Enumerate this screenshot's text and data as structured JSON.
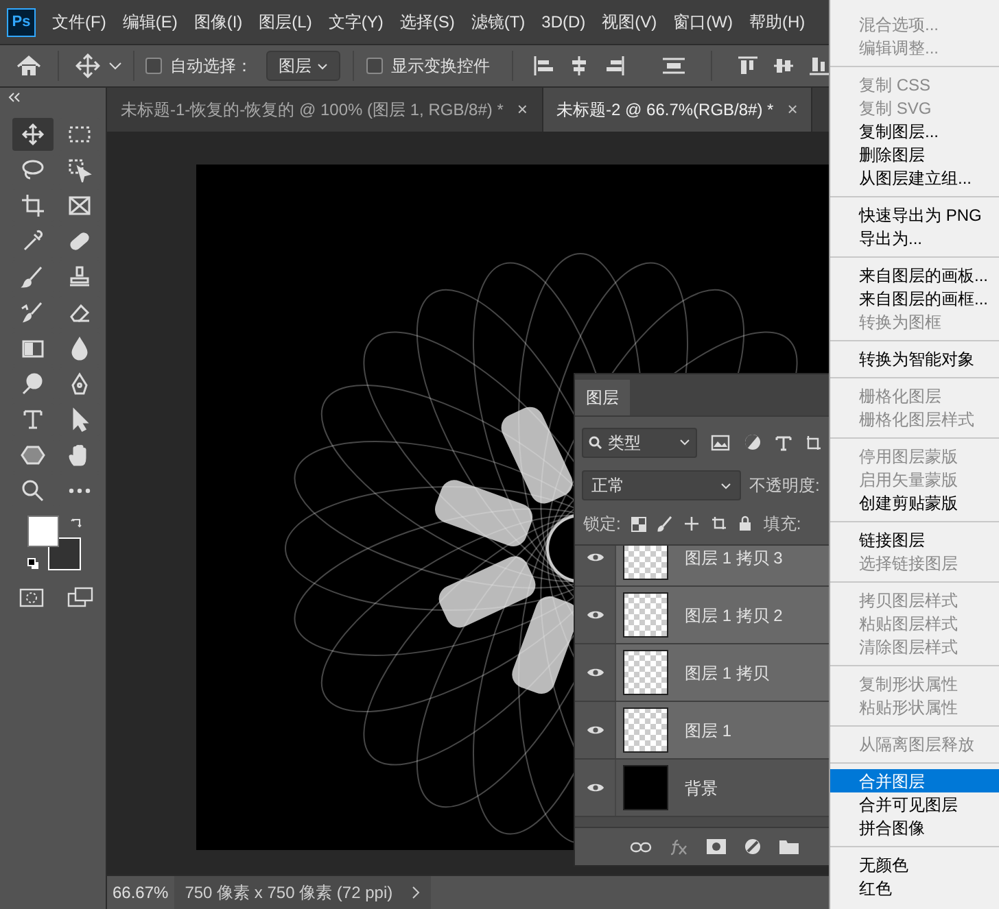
{
  "menubar": {
    "logo": "Ps",
    "items": [
      "文件(F)",
      "编辑(E)",
      "图像(I)",
      "图层(L)",
      "文字(Y)",
      "选择(S)",
      "滤镜(T)",
      "3D(D)",
      "视图(V)",
      "窗口(W)",
      "帮助(H)"
    ]
  },
  "options_bar": {
    "auto_select": {
      "label": "自动选择：",
      "checked": false
    },
    "target": {
      "value": "图层"
    },
    "show_transform": {
      "label": "显示变换控件",
      "checked": false
    }
  },
  "document_tabs": [
    {
      "title": "未标题-1-恢复的-恢复的 @ 100% (图层 1, RGB/8#) *",
      "close": "×",
      "selected": false
    },
    {
      "title": "未标题-2 @ 66.7%(RGB/8#) *",
      "close": "×",
      "selected": true
    }
  ],
  "toolbar": {
    "tools": [
      {
        "selected": true
      },
      {
        "selected": false
      },
      {
        "selected": false
      },
      {
        "selected": false
      },
      {
        "selected": false
      },
      {
        "selected": false
      },
      {
        "selected": false
      },
      {
        "selected": false
      },
      {
        "selected": false
      },
      {
        "selected": false
      },
      {
        "selected": false
      },
      {
        "selected": false
      },
      {
        "selected": false
      },
      {
        "selected": false
      },
      {
        "selected": false
      },
      {
        "selected": false
      },
      {
        "selected": false
      },
      {
        "selected": false
      },
      {
        "selected": false
      },
      {
        "selected": false
      },
      {
        "selected": false
      },
      {
        "selected": false
      }
    ]
  },
  "layers_panel": {
    "tab": "图层",
    "filter": "类型",
    "blend_mode": "正常",
    "opacity_label": "不透明度:",
    "lock_label": "锁定:",
    "fill_label": "填充:",
    "layers": [
      {
        "name": "图层 1 拷贝 3",
        "visible": true,
        "selected": true,
        "kind": "transparent"
      },
      {
        "name": "图层 1 拷贝 2",
        "visible": true,
        "selected": true,
        "kind": "transparent"
      },
      {
        "name": "图层 1 拷贝",
        "visible": true,
        "selected": true,
        "kind": "transparent"
      },
      {
        "name": "图层 1",
        "visible": true,
        "selected": true,
        "kind": "transparent"
      },
      {
        "name": "背景",
        "visible": true,
        "selected": false,
        "kind": "background"
      }
    ]
  },
  "status_bar": {
    "zoom": "66.67%",
    "doc_info": "750 像素 x 750 像素 (72 ppi)"
  },
  "context_menu": {
    "items": [
      {
        "kind": "item",
        "label": "混合选项...",
        "disabled": true,
        "selected": false
      },
      {
        "kind": "item",
        "label": "编辑调整...",
        "disabled": true,
        "selected": false
      },
      {
        "kind": "separator"
      },
      {
        "kind": "item",
        "label": "复制 CSS",
        "disabled": true,
        "selected": false
      },
      {
        "kind": "item",
        "label": "复制 SVG",
        "disabled": true,
        "selected": false
      },
      {
        "kind": "item",
        "label": "复制图层...",
        "disabled": false,
        "selected": false
      },
      {
        "kind": "item",
        "label": "删除图层",
        "disabled": false,
        "selected": false
      },
      {
        "kind": "item",
        "label": "从图层建立组...",
        "disabled": false,
        "selected": false
      },
      {
        "kind": "separator"
      },
      {
        "kind": "item",
        "label": "快速导出为 PNG",
        "disabled": false,
        "selected": false
      },
      {
        "kind": "item",
        "label": "导出为...",
        "disabled": false,
        "selected": false
      },
      {
        "kind": "separator"
      },
      {
        "kind": "item",
        "label": "来自图层的画板...",
        "disabled": false,
        "selected": false
      },
      {
        "kind": "item",
        "label": "来自图层的画框...",
        "disabled": false,
        "selected": false
      },
      {
        "kind": "item",
        "label": "转换为图框",
        "disabled": true,
        "selected": false
      },
      {
        "kind": "separator"
      },
      {
        "kind": "item",
        "label": "转换为智能对象",
        "disabled": false,
        "selected": false
      },
      {
        "kind": "separator"
      },
      {
        "kind": "item",
        "label": "栅格化图层",
        "disabled": true,
        "selected": false
      },
      {
        "kind": "item",
        "label": "栅格化图层样式",
        "disabled": true,
        "selected": false
      },
      {
        "kind": "separator"
      },
      {
        "kind": "item",
        "label": "停用图层蒙版",
        "disabled": true,
        "selected": false
      },
      {
        "kind": "item",
        "label": "启用矢量蒙版",
        "disabled": true,
        "selected": false
      },
      {
        "kind": "item",
        "label": "创建剪贴蒙版",
        "disabled": false,
        "selected": false
      },
      {
        "kind": "separator"
      },
      {
        "kind": "item",
        "label": "链接图层",
        "disabled": false,
        "selected": false
      },
      {
        "kind": "item",
        "label": "选择链接图层",
        "disabled": true,
        "selected": false
      },
      {
        "kind": "separator"
      },
      {
        "kind": "item",
        "label": "拷贝图层样式",
        "disabled": true,
        "selected": false
      },
      {
        "kind": "item",
        "label": "粘贴图层样式",
        "disabled": true,
        "selected": false
      },
      {
        "kind": "item",
        "label": "清除图层样式",
        "disabled": true,
        "selected": false
      },
      {
        "kind": "separator"
      },
      {
        "kind": "item",
        "label": "复制形状属性",
        "disabled": true,
        "selected": false
      },
      {
        "kind": "item",
        "label": "粘贴形状属性",
        "disabled": true,
        "selected": false
      },
      {
        "kind": "separator"
      },
      {
        "kind": "item",
        "label": "从隔离图层释放",
        "disabled": true,
        "selected": false
      },
      {
        "kind": "separator"
      },
      {
        "kind": "item",
        "label": "合并图层",
        "disabled": false,
        "selected": true
      },
      {
        "kind": "item",
        "label": "合并可见图层",
        "disabled": false,
        "selected": false
      },
      {
        "kind": "item",
        "label": "拼合图像",
        "disabled": false,
        "selected": false
      },
      {
        "kind": "separator"
      },
      {
        "kind": "item",
        "label": "无颜色",
        "disabled": false,
        "selected": false
      },
      {
        "kind": "item",
        "label": "红色",
        "disabled": false,
        "selected": false
      }
    ]
  }
}
